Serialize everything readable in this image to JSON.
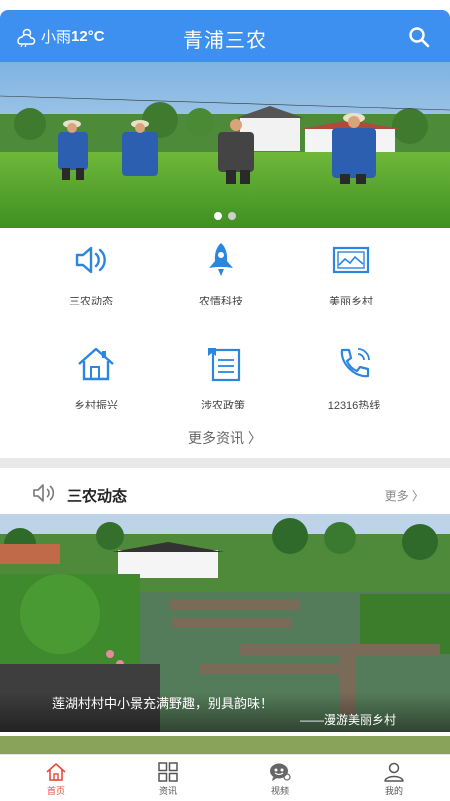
{
  "header": {
    "weather_text": "小雨",
    "temperature": "12°C",
    "title": "青浦三农"
  },
  "banner": {
    "slide_count": 2,
    "active_slide": 1
  },
  "categories": [
    {
      "label": "三农动态",
      "icon": "speaker-icon"
    },
    {
      "label": "农情科技",
      "icon": "rocket-icon"
    },
    {
      "label": "美丽乡村",
      "icon": "landscape-frame-icon"
    },
    {
      "label": "乡村振兴",
      "icon": "house-icon"
    },
    {
      "label": "涉农政策",
      "icon": "document-icon"
    },
    {
      "label": "12316热线",
      "icon": "phone-icon"
    }
  ],
  "more_news": "更多资讯 〉",
  "section": {
    "title": "三农动态",
    "more": "更多 〉",
    "caption": "莲湖村村中小景充满野趣，别具韵味！",
    "caption_source": "——漫游美丽乡村"
  },
  "tabs": [
    {
      "label": "首页",
      "icon": "home-icon",
      "active": true
    },
    {
      "label": "资讯",
      "icon": "grid-icon",
      "active": false
    },
    {
      "label": "视频",
      "icon": "video-chat-icon",
      "active": false
    },
    {
      "label": "我的",
      "icon": "user-icon",
      "active": false
    }
  ],
  "colors": {
    "primary": "#3d8ff0",
    "icon_blue": "#2b86e0",
    "tab_active": "#e64b3c"
  }
}
